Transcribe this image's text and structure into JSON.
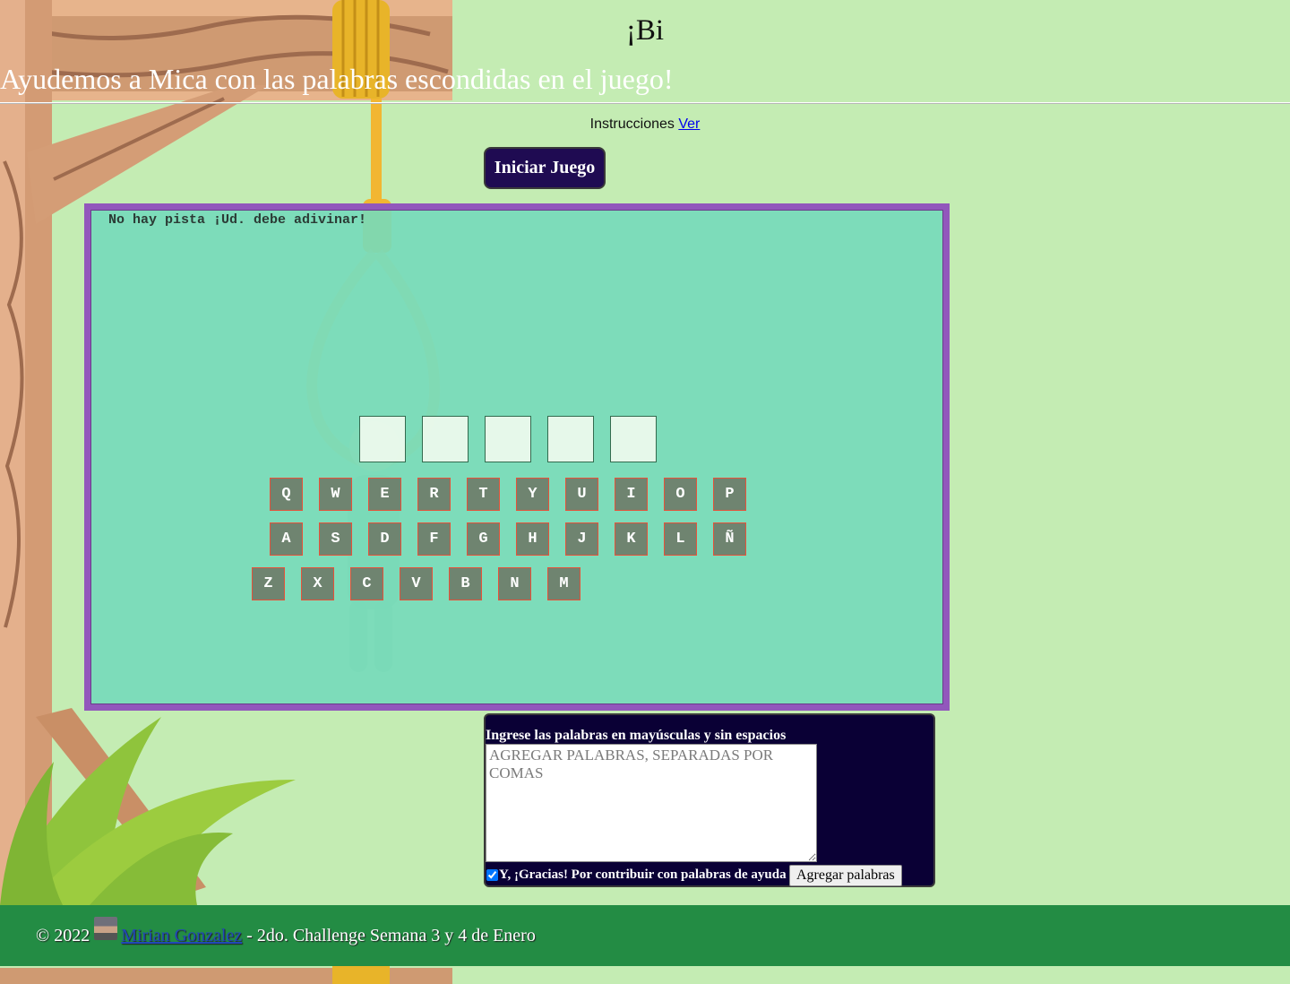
{
  "header": {
    "title": "¡Bi",
    "subtitle": "Ayudemos a Mica con las palabras escondidas en el juego!"
  },
  "instructions": {
    "label": "Instrucciones",
    "link_text": "Ver"
  },
  "start_button_label": "Iniciar Juego",
  "game": {
    "hint": "No hay pista ¡Ud. debe adivinar!",
    "letter_slots": 5,
    "keyboard_rows": [
      [
        "Q",
        "W",
        "E",
        "R",
        "T",
        "Y",
        "U",
        "I",
        "O",
        "P"
      ],
      [
        "A",
        "S",
        "D",
        "F",
        "G",
        "H",
        "J",
        "K",
        "L",
        "Ñ"
      ],
      [
        "Z",
        "X",
        "C",
        "V",
        "B",
        "N",
        "M"
      ]
    ]
  },
  "add_words": {
    "label": "Ingrese las palabras en mayúsculas y sin espacios",
    "placeholder": "AGREGAR PALABRAS, SEPARADAS POR COMAS",
    "checkbox_label": "Y, ¡Gracias! Por contribuir con palabras de ayuda",
    "checkbox_checked": true,
    "button_label": "Agregar palabras"
  },
  "footer": {
    "copyright": "© 2022",
    "author": "Mirian Gonzalez",
    "description": "- 2do. Challenge Semana 3 y 4 de Enero"
  },
  "colors": {
    "page_background": "#c4ecb3",
    "board_border": "#9257bc",
    "board_background": "#80ddb6",
    "button_background": "#1f0b52",
    "footer_background": "#238c44"
  }
}
